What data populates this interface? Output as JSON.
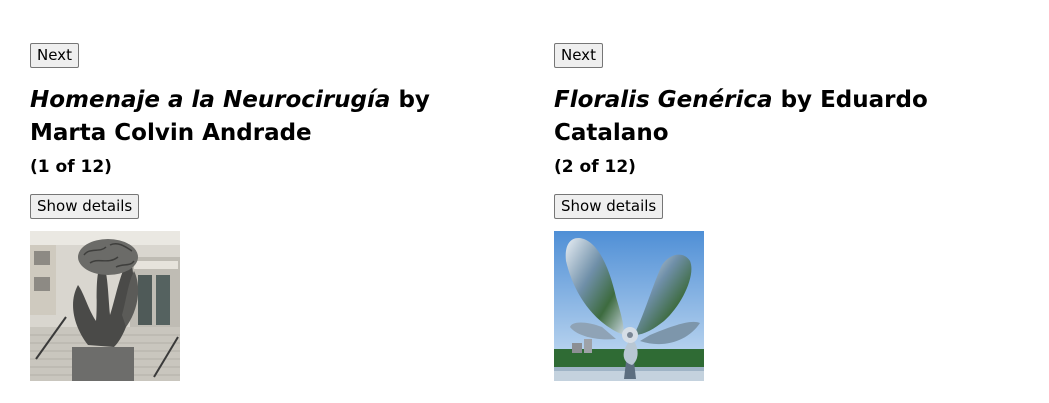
{
  "galleries": [
    {
      "next_label": "Next",
      "title": "Homenaje a la Neurocirugía",
      "by": "by",
      "artist": "Marta Colvin Andrade",
      "counter": "(1 of 12)",
      "details_label": "Show details",
      "image_alt": "Homenaje a la Neurocirugía"
    },
    {
      "next_label": "Next",
      "title": "Floralis Genérica",
      "by": "by",
      "artist": "Eduardo Catalano",
      "counter": "(2 of 12)",
      "details_label": "Show details",
      "image_alt": "Floralis Genérica"
    }
  ]
}
